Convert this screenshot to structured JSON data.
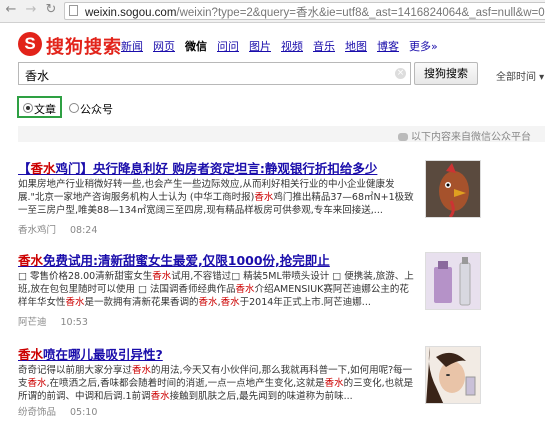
{
  "browser": {
    "url_domain": "weixin.sogou.com",
    "url_rest": "/weixin?type=2&query=香水&ie=utf8&_ast=1416824064&_asf=null&w=0"
  },
  "logo": {
    "letter": "S",
    "text": "搜狗搜索"
  },
  "channels": [
    {
      "label": "新闻",
      "active": false
    },
    {
      "label": "网页",
      "active": false
    },
    {
      "label": "微信",
      "active": true
    },
    {
      "label": "问问",
      "active": false
    },
    {
      "label": "图片",
      "active": false
    },
    {
      "label": "视频",
      "active": false
    },
    {
      "label": "音乐",
      "active": false
    },
    {
      "label": "地图",
      "active": false
    },
    {
      "label": "博客",
      "active": false
    },
    {
      "label": "更多»",
      "active": false
    }
  ],
  "search": {
    "value": "香水",
    "button_label": "搜狗搜索",
    "time_filter": "全部时间"
  },
  "filters": {
    "article_label": "文章",
    "account_label": "公众号",
    "selected": "文章"
  },
  "source_note": "以下内容来自微信公众平台",
  "results": [
    {
      "title_parts": [
        "【",
        "香水",
        "鸡门】央行降息利好 购房者资定坦言:静观银行折扣给多少"
      ],
      "snippet": "如果房地产行业稍微好转一些,也会产生一些边际效应,从而利好相关行业的中小企业健康发展.\"北京一家地产咨询服务机构人士认为 (中华工商时报)香水鸡门推出精品37—68㎡N+1极致一至三房户型,唯美88—134㎡宽阔三至四房,现有精品样板房可供参观,专车来回接送,...",
      "author": "香水鸡门",
      "time": "08:24",
      "thumb": "chicken-mask-photo"
    },
    {
      "title_parts": [
        "",
        "香水",
        "免费试用:清新甜蜜女生最爱,仅限1000份,抢完即止"
      ],
      "snippet": "□ 零售价格28.00清新甜蜜女生香水试用,不容错过□ 精装5ML带喷头设计 □ 便携装,旅游、上班,放在包包里随时可以使用 □ 法国调香师经典作品香水介绍AMENSIUK赛阿芒迪娜公主的花样年华女性香水是一款拥有清新花果香调的香水,香水于2014年正式上市.阿芒迪娜...",
      "author": "阿芒迪",
      "time": "10:53",
      "thumb": "perfume-bottle-photo"
    },
    {
      "title_parts": [
        "",
        "香水",
        "喷在哪儿最吸引异性?"
      ],
      "snippet": "奇奇记得以前朋大家分享过香水的用法,今天又有小伙伴问,那么我就再科普一下,如何用呢?每一支香水,在喷洒之后,香味都会随着时间的消逝,一点一点地产生变化,这就是香水的三变化,也就是所谓的前调、中调和后调.1前调香水接触到肌肤之后,最先闻到的味道称为前味...",
      "author": "纷奇饰品",
      "time": "05:10",
      "thumb": "woman-perfume-photo"
    }
  ]
}
